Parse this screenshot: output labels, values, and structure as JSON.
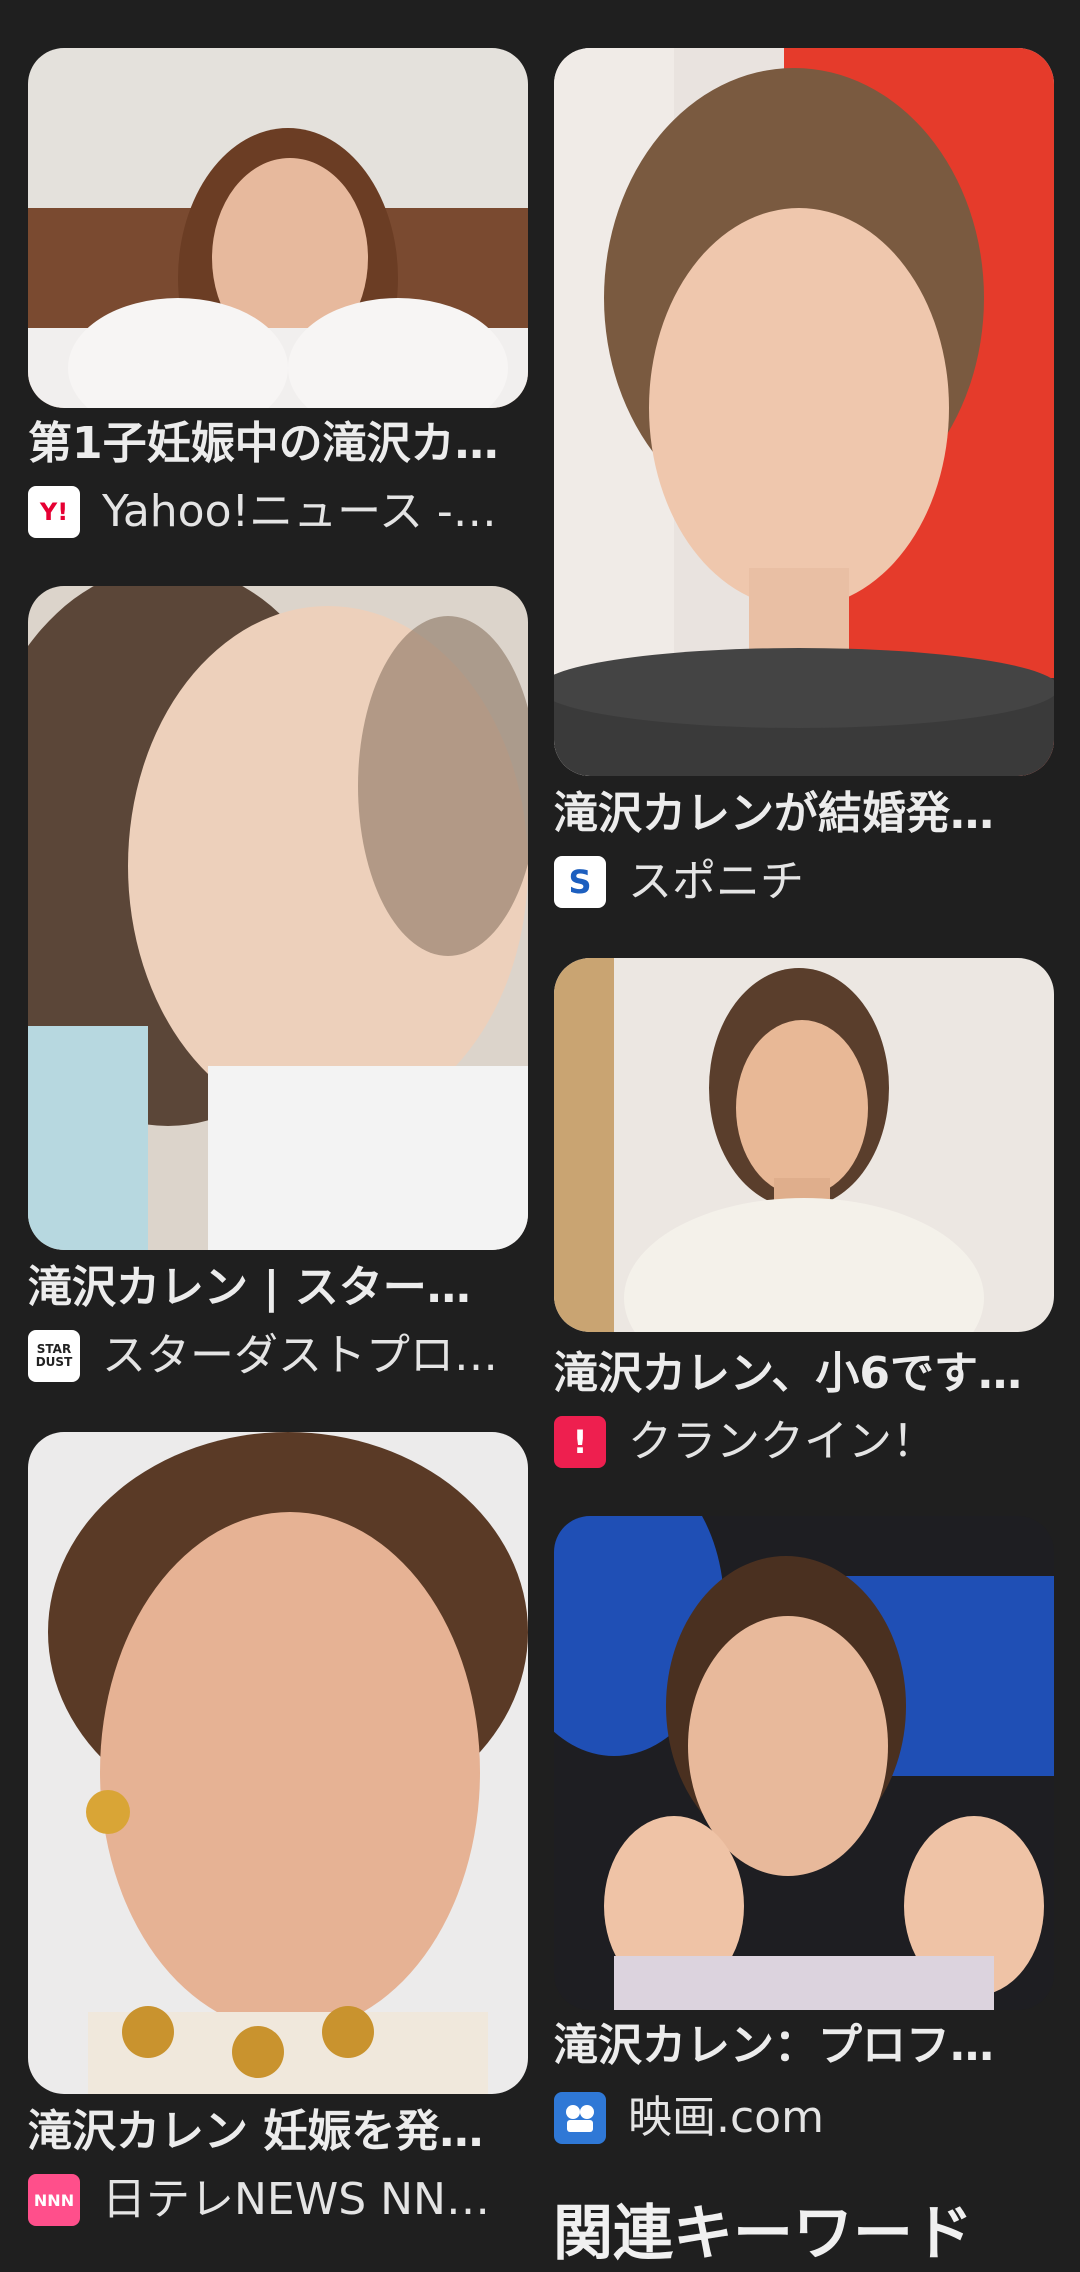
{
  "results": [
    {
      "title": "第1子妊娠中の滝沢カ…",
      "source": "Yahoo!ニュース -…",
      "favicon": "yahoo-news-icon",
      "favicon_text": "Y!",
      "favicon_bg": "#ffffff",
      "favicon_fg": "#e60033"
    },
    {
      "title": "滝沢カレンが結婚発…",
      "source": "スポニチ",
      "favicon": "sponichi-icon",
      "favicon_text": "S",
      "favicon_bg": "#ffffff",
      "favicon_fg": "#1d5fbf"
    },
    {
      "title": "滝沢カレン | スター…",
      "source": "スターダストプロ…",
      "favicon": "stardust-icon",
      "favicon_text": "STAR DUST",
      "favicon_bg": "#ffffff",
      "favicon_fg": "#222222"
    },
    {
      "title": "滝沢カレン、小6です…",
      "source": "クランクイン！",
      "favicon": "crankin-icon",
      "favicon_text": "!",
      "favicon_bg": "#ee1f4f",
      "favicon_fg": "#ffffff"
    },
    {
      "title": "滝沢カレン 妊娠を発…",
      "source": "日テレNEWS NN…",
      "favicon": "ntv-news-icon",
      "favicon_text": "NNN",
      "favicon_bg": "#ff4f8b",
      "favicon_fg": "#ffffff"
    },
    {
      "title": "滝沢カレン：プロフ…",
      "source": "映画.com",
      "favicon": "eiga-com-icon",
      "favicon_text": "",
      "favicon_bg": "#2f78d6",
      "favicon_fg": "#ffffff"
    }
  ],
  "related": {
    "heading": "関連キーワード"
  }
}
